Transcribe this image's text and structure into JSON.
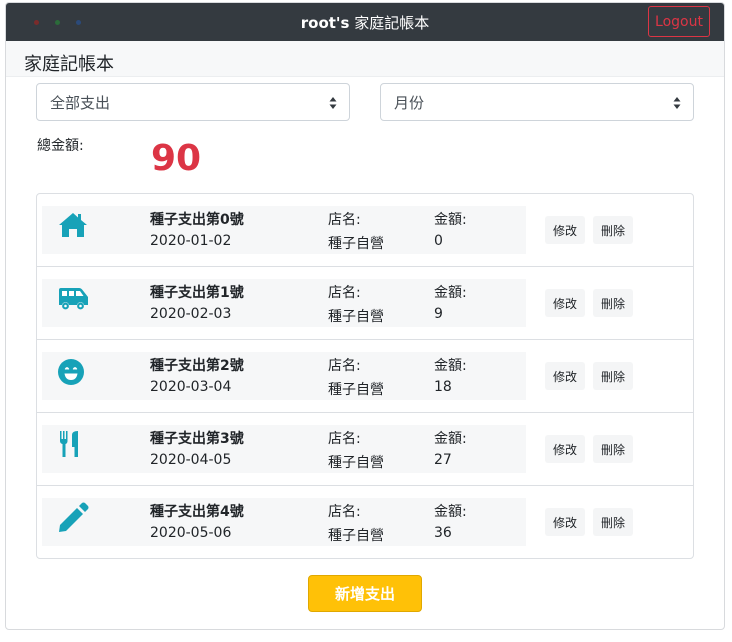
{
  "app": {
    "title_user": "root's",
    "title_name": "家庭記帳本",
    "logout_label": "Logout",
    "window_dots": [
      "#7a2b2b",
      "#2b6b3a",
      "#2b4a7a"
    ]
  },
  "page": {
    "title": "家庭記帳本"
  },
  "filters": {
    "category_selected": "全部支出",
    "month_selected": "月份"
  },
  "total": {
    "label": "總金額:",
    "value": "90"
  },
  "expenses": [
    {
      "icon": "home-icon",
      "name_prefix": "種子支出第",
      "num": "0",
      "name_suffix": "號",
      "date": "2020-01-02",
      "shop_label": "店名:",
      "shop": "種子自營",
      "amount_label": "金額:",
      "amount": "0",
      "edit_label": "修改",
      "delete_label": "刪除"
    },
    {
      "icon": "shuttle-van-icon",
      "name_prefix": "種子支出第",
      "num": "1",
      "name_suffix": "號",
      "date": "2020-02-03",
      "shop_label": "店名:",
      "shop": "種子自營",
      "amount_label": "金額:",
      "amount": "9",
      "edit_label": "修改",
      "delete_label": "刪除"
    },
    {
      "icon": "grin-icon",
      "name_prefix": "種子支出第",
      "num": "2",
      "name_suffix": "號",
      "date": "2020-03-04",
      "shop_label": "店名:",
      "shop": "種子自營",
      "amount_label": "金額:",
      "amount": "18",
      "edit_label": "修改",
      "delete_label": "刪除"
    },
    {
      "icon": "utensils-icon",
      "name_prefix": "種子支出第",
      "num": "3",
      "name_suffix": "號",
      "date": "2020-04-05",
      "shop_label": "店名:",
      "shop": "種子自營",
      "amount_label": "金額:",
      "amount": "27",
      "edit_label": "修改",
      "delete_label": "刪除"
    },
    {
      "icon": "pen-icon",
      "name_prefix": "種子支出第",
      "num": "4",
      "name_suffix": "號",
      "date": "2020-05-06",
      "shop_label": "店名:",
      "shop": "種子自營",
      "amount_label": "金額:",
      "amount": "36",
      "edit_label": "修改",
      "delete_label": "刪除"
    }
  ],
  "add_button": {
    "label": "新增支出"
  },
  "colors": {
    "accent_icon": "#17a2b8",
    "total": "#dc3545",
    "add_button": "#ffc107",
    "navbar": "#343a40"
  }
}
